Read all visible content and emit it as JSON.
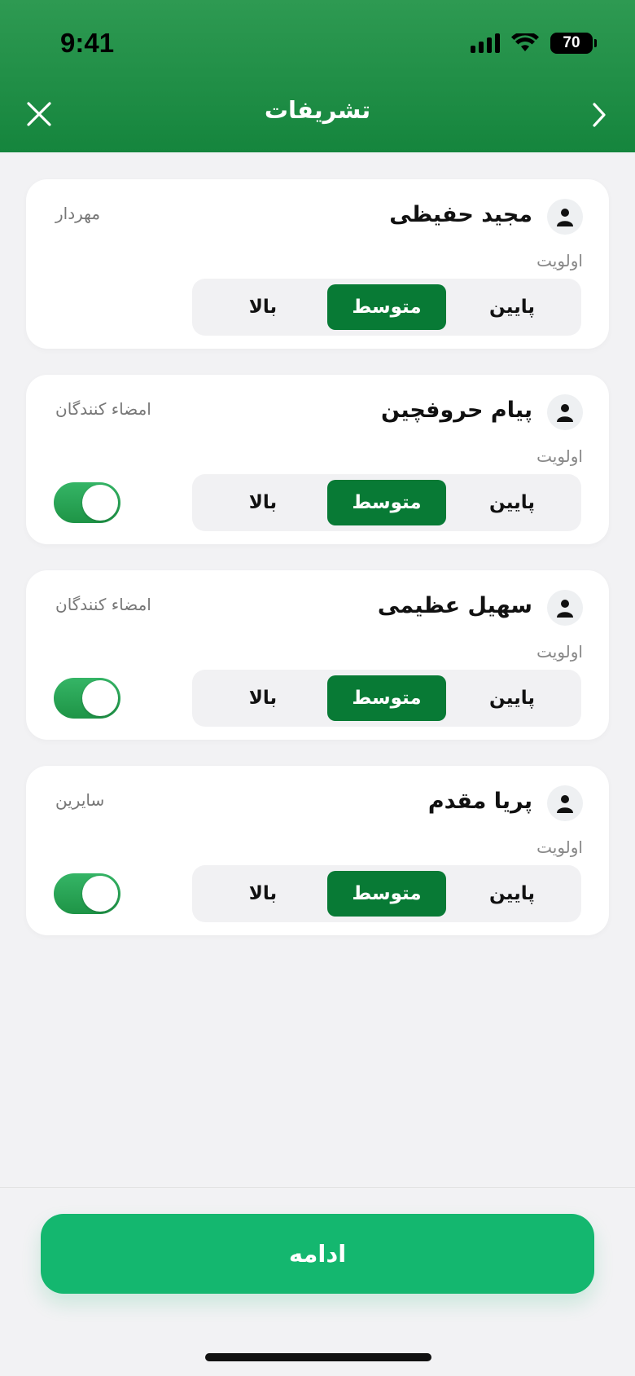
{
  "status_bar": {
    "time": "9:41",
    "battery": "70"
  },
  "nav": {
    "title": "تشریفات",
    "close_icon": "close-icon",
    "forward_icon": "chevron-right-icon"
  },
  "priority_label": "اولویت",
  "priority_options": {
    "low": "پایین",
    "medium": "متوسط",
    "high": "بالا"
  },
  "cards": [
    {
      "name": "مجید حفیظی",
      "role": "مهردار",
      "selected_priority": "medium",
      "has_toggle": false
    },
    {
      "name": "پیام حروفچین",
      "role": "امضاء کنندگان",
      "selected_priority": "medium",
      "has_toggle": true,
      "toggle_on": true
    },
    {
      "name": "سهیل عظیمی",
      "role": "امضاء کنندگان",
      "selected_priority": "medium",
      "has_toggle": true,
      "toggle_on": true
    },
    {
      "name": "پریا مقدم",
      "role": "سایرین",
      "selected_priority": "medium",
      "has_toggle": true,
      "toggle_on": true
    }
  ],
  "footer": {
    "continue_label": "ادامه"
  },
  "colors": {
    "header": "#15853d",
    "accent": "#087a35",
    "button": "#14b76f"
  }
}
